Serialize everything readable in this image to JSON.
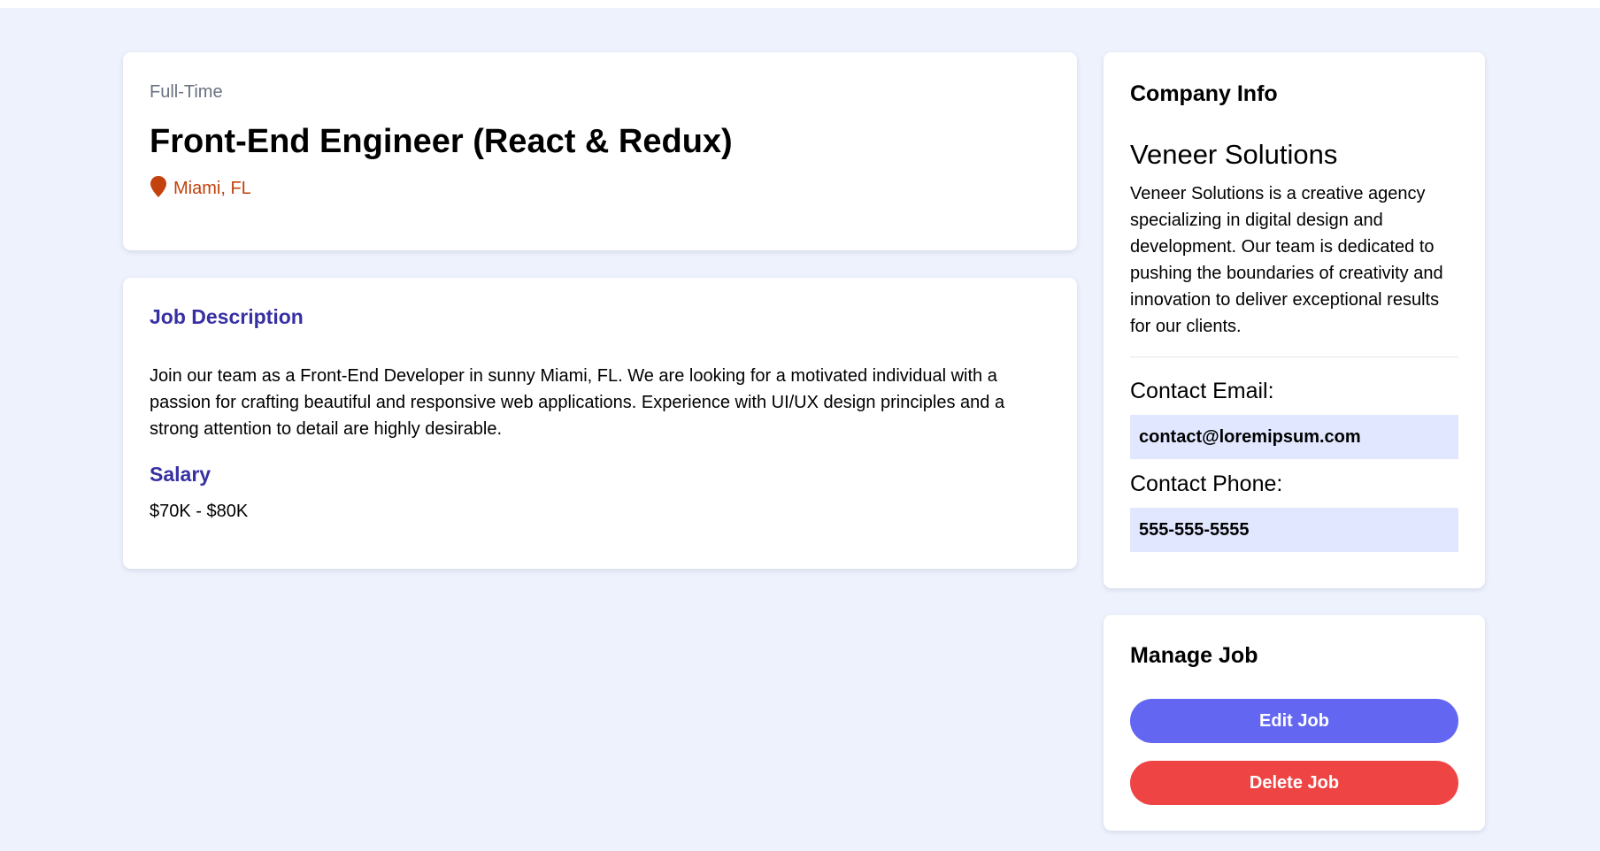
{
  "job": {
    "type": "Full-Time",
    "title": "Front-End Engineer (React & Redux)",
    "location": "Miami, FL",
    "location_icon": "map-pin-icon",
    "location_color": "#c2410c"
  },
  "description": {
    "heading": "Job Description",
    "text": "Join our team as a Front-End Developer in sunny Miami, FL. We are looking for a motivated individual with a passion for crafting beautiful and responsive web applications. Experience with UI/UX design principles and a strong attention to detail are highly desirable.",
    "salary_heading": "Salary",
    "salary": "$70K - $80K",
    "heading_color": "#3730a3"
  },
  "company": {
    "heading": "Company Info",
    "name": "Veneer Solutions",
    "description": "Veneer Solutions is a creative agency specializing in digital design and development. Our team is dedicated to pushing the boundaries of creativity and innovation to deliver exceptional results for our clients.",
    "email_label": "Contact Email:",
    "email": "contact@loremipsum.com",
    "phone_label": "Contact Phone:",
    "phone": "555-555-5555"
  },
  "manage": {
    "heading": "Manage Job",
    "edit_label": "Edit Job",
    "delete_label": "Delete Job",
    "edit_color": "#6366f1",
    "delete_color": "#ef4444"
  },
  "colors": {
    "page_background": "#eef2fd",
    "contact_box": "#e0e7ff"
  }
}
